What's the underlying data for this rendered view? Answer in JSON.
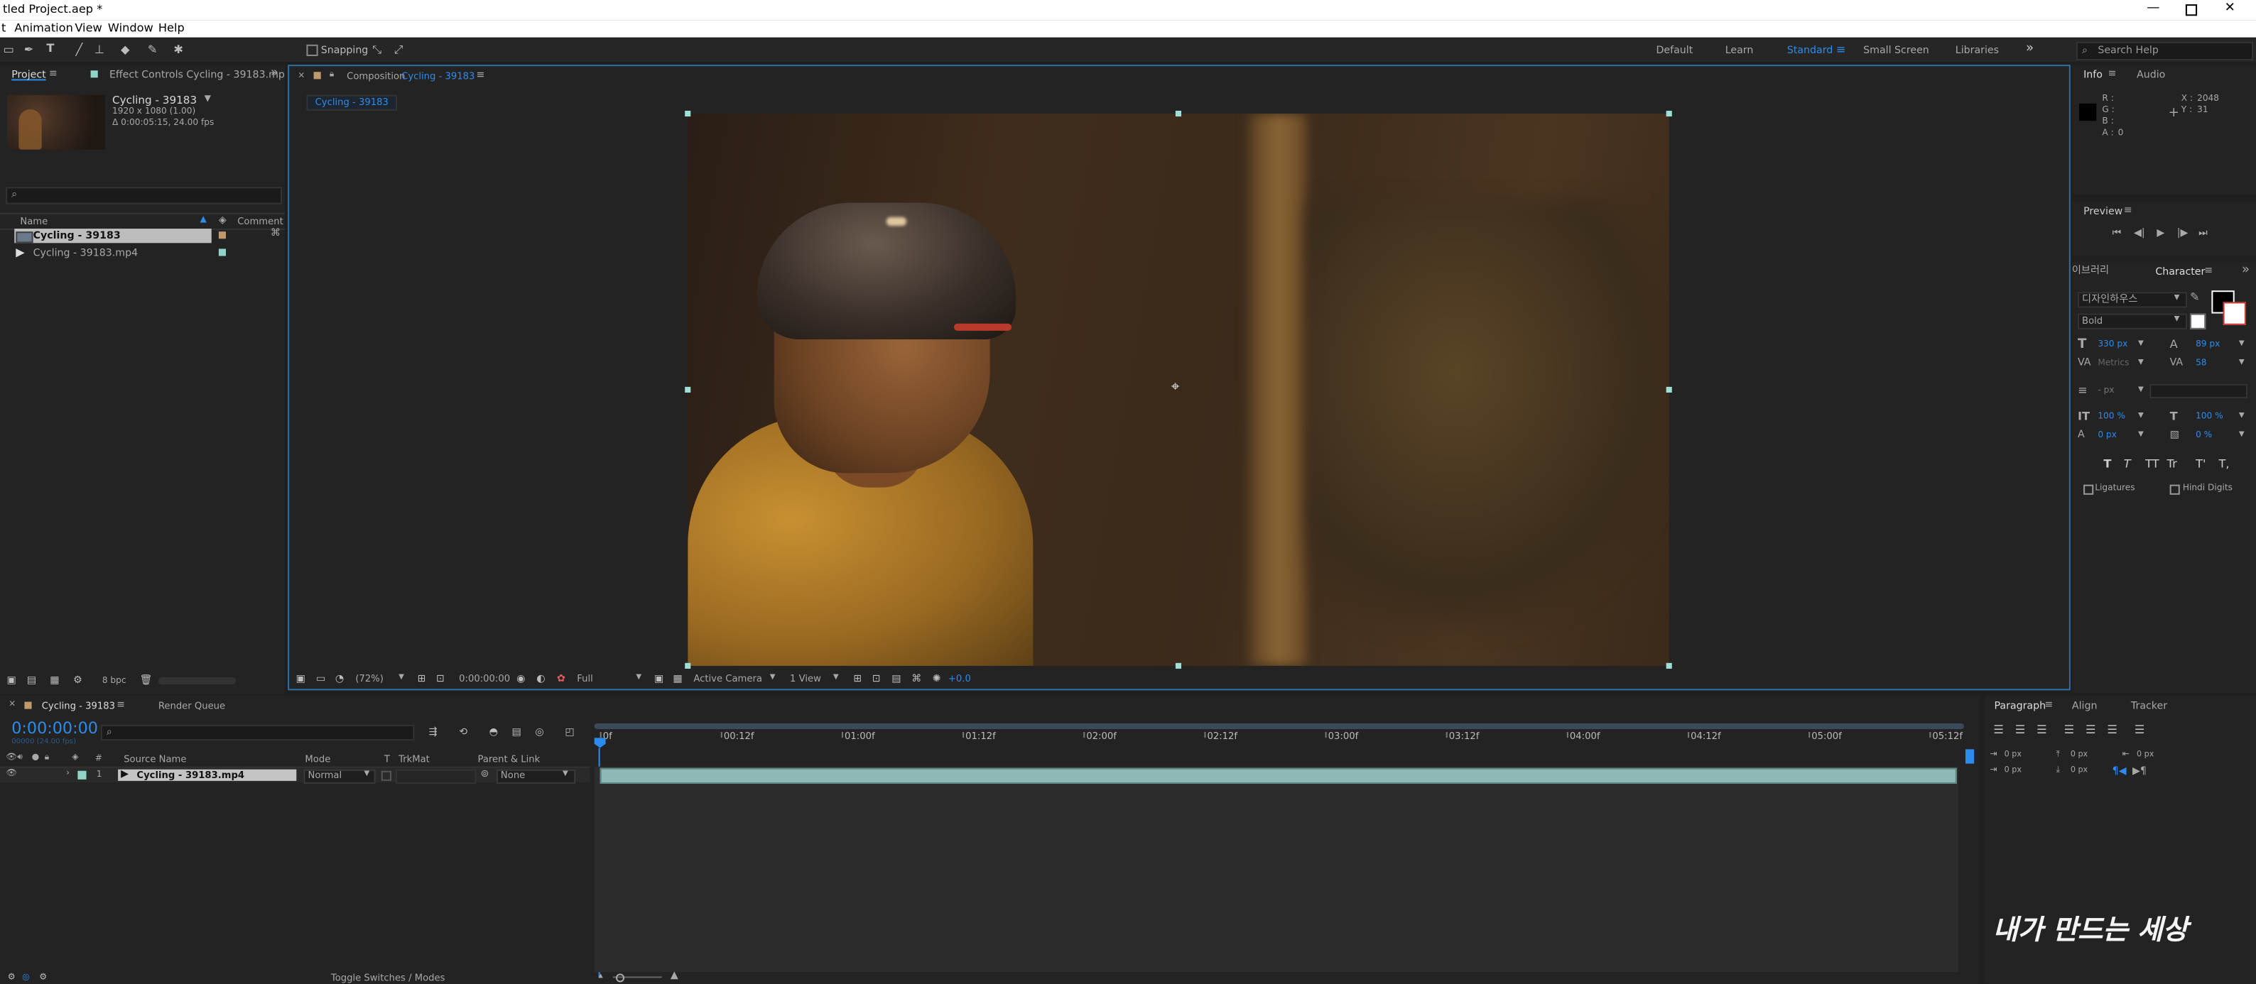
{
  "window": {
    "title": "tled Project.aep *"
  },
  "menu": [
    "t",
    "Animation",
    "View",
    "Window",
    "Help"
  ],
  "toolbar": {
    "snapping_label": "Snapping",
    "workspaces": [
      "Default",
      "Learn",
      "Standard",
      "Small Screen",
      "Libraries"
    ],
    "search_placeholder": "Search Help"
  },
  "project_panel": {
    "tabs": [
      "Project",
      "Effect Controls  Cycling - 39183.mp"
    ],
    "item_name": "Cycling - 39183",
    "item_info": [
      "1920 x 1080 (1.00)",
      "Δ 0:00:05:15, 24.00 fps"
    ],
    "columns": {
      "name": "Name",
      "comment": "Comment"
    },
    "items": [
      {
        "name": "Cycling - 39183",
        "color": "#c19a6b"
      },
      {
        "name": "Cycling - 39183.mp4",
        "color": "#8fd3c9"
      }
    ],
    "bpc": "8 bpc"
  },
  "composition": {
    "tab_label": "Composition",
    "tab_name": "Cycling - 39183",
    "breadcrumb": "Cycling - 39183",
    "footer": {
      "zoom": "(72%)",
      "time": "0:00:00:00",
      "resolution": "Full",
      "camera": "Active Camera",
      "view": "1 View",
      "exposure": "+0.0"
    }
  },
  "info_panel": {
    "tabs": [
      "Info",
      "Audio"
    ],
    "rgba_labels": [
      "R :",
      "G :",
      "B :",
      "A :"
    ],
    "a_value": "0",
    "x_label": "X :",
    "x_value": "2048",
    "y_label": "Y :",
    "y_value": "31"
  },
  "preview_panel": {
    "title": "Preview"
  },
  "character_panel": {
    "tabs": [
      "이브러리",
      "Character"
    ],
    "font_family": "디자인하우스",
    "font_style": "Bold",
    "size": "330 px",
    "leading": "89 px",
    "kerning": "Metrics",
    "tracking": "58",
    "stroke": "- px",
    "vscale": "100 %",
    "hscale": "100 %",
    "baseline": "0 px",
    "tsume": "0 %",
    "style_buttons": [
      "T",
      "T",
      "TT",
      "Tr",
      "T'",
      "T,"
    ],
    "ligatures": "Ligatures",
    "hindi": "Hindi Digits"
  },
  "timeline": {
    "tabs": [
      "Cycling - 39183",
      "Render Queue"
    ],
    "current_time": "0:00:00:00",
    "fps_note": "00000 (24.00 fps)",
    "ruler": [
      "0f",
      "00:12f",
      "01:00f",
      "01:12f",
      "02:00f",
      "02:12f",
      "03:00f",
      "03:12f",
      "04:00f",
      "04:12f",
      "05:00f",
      "05:12f"
    ],
    "columns": {
      "num": "#",
      "source": "Source Name",
      "mode": "Mode",
      "t": "T",
      "trkmat": "TrkMat",
      "parent": "Parent & Link"
    },
    "layer": {
      "num": "1",
      "name": "Cycling - 39183.mp4",
      "mode": "Normal",
      "parent": "None"
    },
    "toggle_label": "Toggle Switches / Modes"
  },
  "paragraph_panel": {
    "tabs": [
      "Paragraph",
      "Align",
      "Tracker"
    ],
    "indents": [
      "0 px",
      "0 px",
      "0 px",
      "0 px",
      "0 px"
    ]
  },
  "watermark": "내가 만드는 세상",
  "colors": {
    "accent": "#2d8ceb",
    "panel_bg": "#232323",
    "layer_bar": "#8fb7b3"
  }
}
